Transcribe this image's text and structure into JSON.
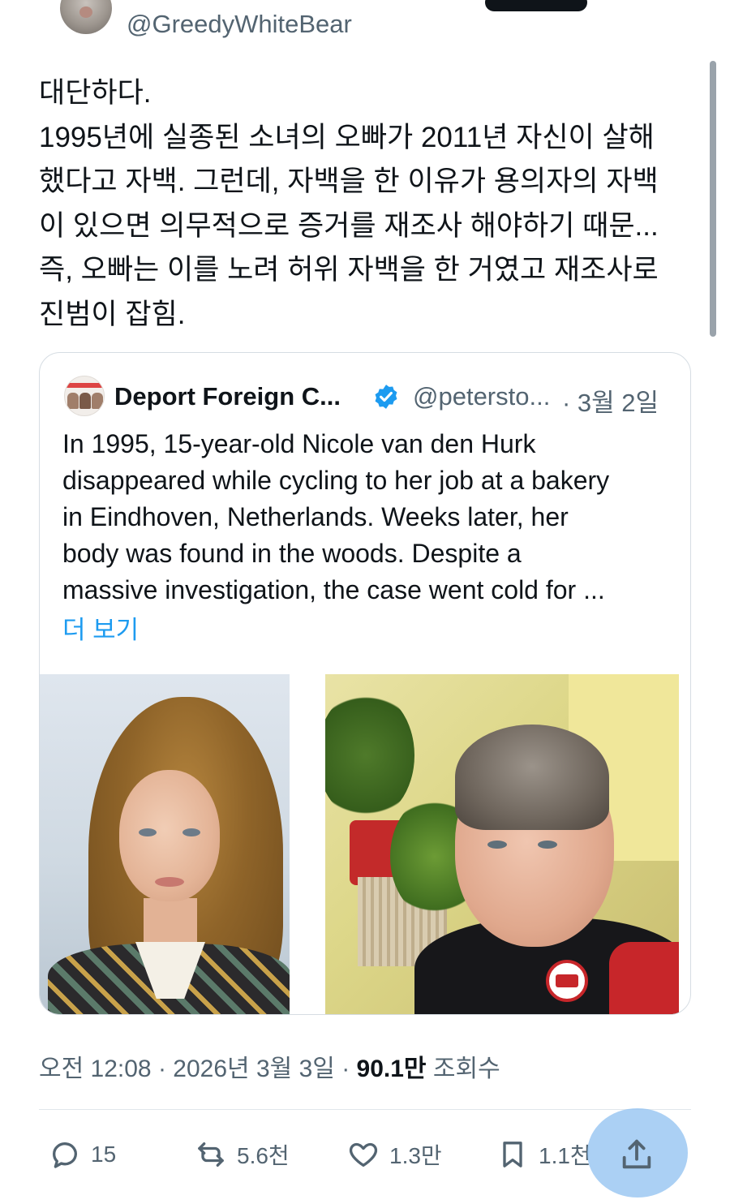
{
  "author": {
    "handle": "@GreedyWhiteBear"
  },
  "tweet": {
    "lines": [
      "대단하다.",
      "1995년에 실종된 소녀의 오빠가 2011년 자신이 살해",
      "했다고 자백. 그런데, 자백을 한 이유가 용의자의 자백",
      "이 있으면 의무적으로 증거를 재조사 해야하기 때문...",
      "즉, 오빠는 이를 노려 허위 자백을 한 거였고 재조사로",
      "진범이 잡힘."
    ]
  },
  "quoted": {
    "name": "Deport Foreign C...",
    "handle": "@petersto...",
    "date": "· 3월 2일",
    "lines": [
      "In 1995, 15-year-old Nicole van den Hurk",
      "disappeared while cycling to her job at a bakery",
      "in Eindhoven, Netherlands. Weeks later, her",
      "body was found in the woods. Despite a",
      "massive investigation, the case went cold for ..."
    ],
    "show_more": "더 보기",
    "verified_color": "#1d9bf0"
  },
  "meta": {
    "time": "오전 12:08",
    "sep1": " · ",
    "date": "2026년 3월 3일",
    "sep2": " · ",
    "views": "90.1만",
    "views_label": " 조회수"
  },
  "actions": {
    "reply": "15",
    "retweet": "5.6천",
    "like": "1.3만",
    "bookmark": "1.1천"
  },
  "colors": {
    "text": "#0f1419",
    "secondary": "#536471",
    "link": "#1d9bf0",
    "border": "#d6dde3"
  }
}
